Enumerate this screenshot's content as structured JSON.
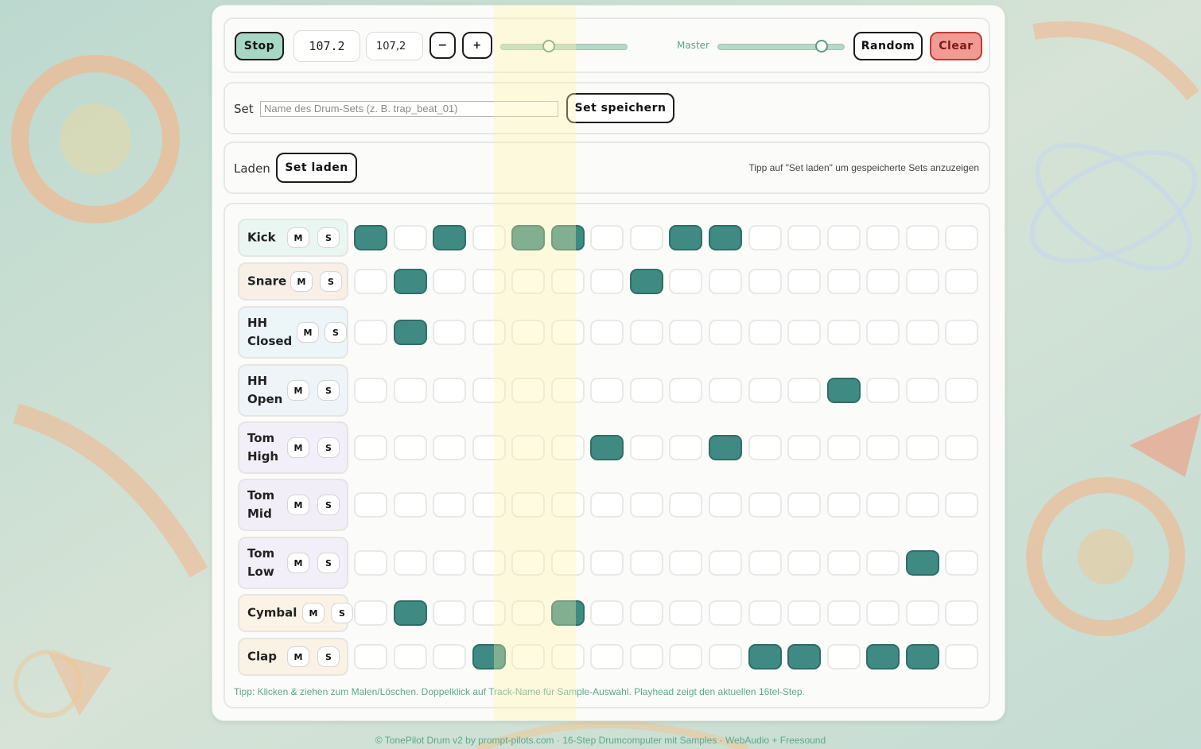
{
  "colors": {
    "accent": "#3f8b83",
    "stop": "#a6d7c5",
    "clear": "#f29a94",
    "hint": "#5aa88d",
    "playhead": "#fff3aa"
  },
  "toolbar": {
    "stop_label": "Stop",
    "bpm_display": "107.2",
    "bpm_input": "107,2",
    "minus_label": "−",
    "plus_label": "+",
    "tempo_slider_value": 0.36,
    "master_label": "Master",
    "master_slider_value": 0.85,
    "random_label": "Random",
    "clear_label": "Clear"
  },
  "save": {
    "label": "Set",
    "placeholder": "Name des Drum-Sets (z. B. trap_beat_01)",
    "button": "Set speichern"
  },
  "load": {
    "label": "Laden",
    "button": "Set laden",
    "hint": "Tipp auf \"Set laden\" um gespeicherte Sets anzuzeigen"
  },
  "sequencer": {
    "steps": 16,
    "playhead_steps": [
      4,
      5
    ],
    "mute_label": "M",
    "solo_label": "S",
    "tracks": [
      {
        "name": "Kick",
        "bg": "#eaf6f1",
        "steps": [
          1,
          0,
          1,
          0,
          1,
          1,
          0,
          0,
          1,
          1,
          0,
          0,
          0,
          0,
          0,
          0
        ]
      },
      {
        "name": "Snare",
        "bg": "#f8efe6",
        "steps": [
          0,
          1,
          0,
          0,
          0,
          0,
          0,
          1,
          0,
          0,
          0,
          0,
          0,
          0,
          0,
          0
        ]
      },
      {
        "name": "HH Closed",
        "bg": "#ecf5f8",
        "steps": [
          0,
          1,
          0,
          0,
          0,
          0,
          0,
          0,
          0,
          0,
          0,
          0,
          0,
          0,
          0,
          0
        ]
      },
      {
        "name": "HH Open",
        "bg": "#eef4f8",
        "steps": [
          0,
          0,
          0,
          0,
          0,
          0,
          0,
          0,
          0,
          0,
          0,
          0,
          1,
          0,
          0,
          0
        ]
      },
      {
        "name": "Tom High",
        "bg": "#f3eff8",
        "steps": [
          0,
          0,
          0,
          0,
          0,
          0,
          1,
          0,
          0,
          1,
          0,
          0,
          0,
          0,
          0,
          0
        ]
      },
      {
        "name": "Tom Mid",
        "bg": "#f2eef8",
        "steps": [
          0,
          0,
          0,
          0,
          0,
          0,
          0,
          0,
          0,
          0,
          0,
          0,
          0,
          0,
          0,
          0
        ]
      },
      {
        "name": "Tom Low",
        "bg": "#f3eff8",
        "steps": [
          0,
          0,
          0,
          0,
          0,
          0,
          0,
          0,
          0,
          0,
          0,
          0,
          0,
          0,
          1,
          0
        ]
      },
      {
        "name": "Cymbal",
        "bg": "#faf3e6",
        "steps": [
          0,
          1,
          0,
          0,
          0,
          1,
          0,
          0,
          0,
          0,
          0,
          0,
          0,
          0,
          0,
          0
        ]
      },
      {
        "name": "Clap",
        "bg": "#faf2e4",
        "steps": [
          0,
          0,
          0,
          1,
          0,
          0,
          0,
          0,
          0,
          0,
          1,
          1,
          0,
          1,
          1,
          0
        ]
      }
    ]
  },
  "tip": "Tipp: Klicken & ziehen zum Malen/Löschen. Doppelklick auf Track-Name für Sample-Auswahl. Playhead zeigt den aktuellen 16tel-Step.",
  "footer": "© TonePilot Drum v2 by prompt-pilots.com · 16-Step Drumcomputer mit Samples · WebAudio + Freesound"
}
